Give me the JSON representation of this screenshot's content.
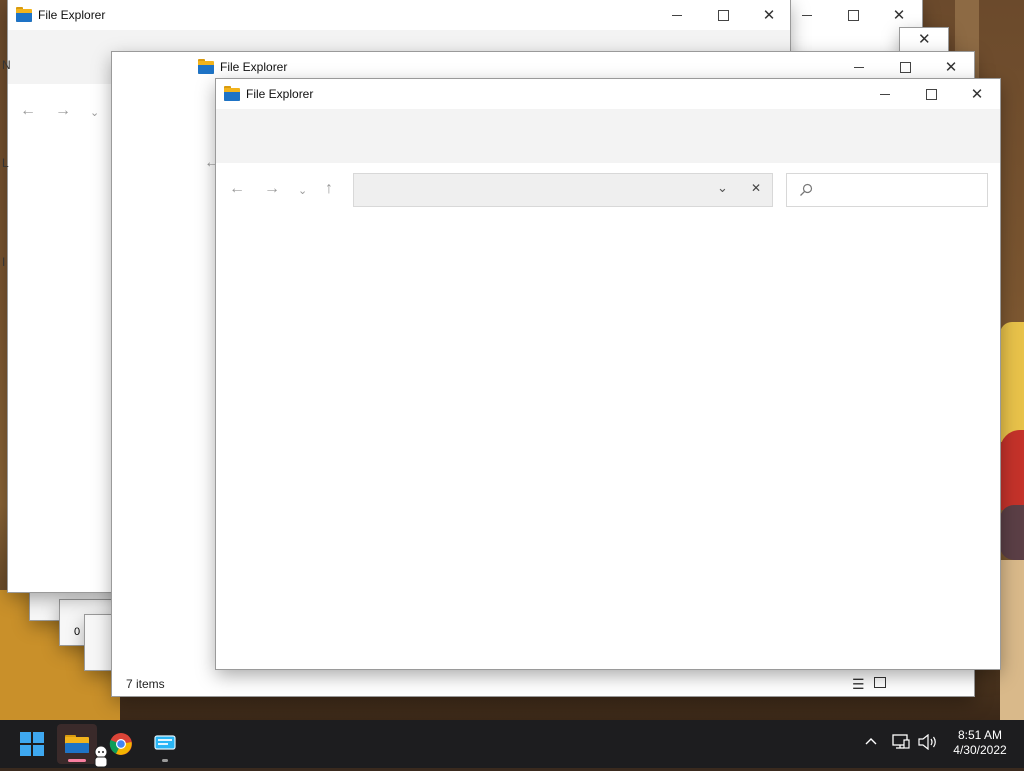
{
  "desktop": {
    "colors": {
      "taskbar": "#1d1d1f",
      "ribbon": "#f3f3f3",
      "accent_indicator": "#f87fa0"
    }
  },
  "windows": [
    {
      "title": "File Explorer",
      "icons": [
        "folder-icon",
        "minimize-icon",
        "maximize-icon",
        "close-icon"
      ]
    },
    {
      "title": "File Explorer",
      "status": "7 items",
      "icons": [
        "folder-icon",
        "minimize-icon",
        "maximize-icon",
        "close-icon",
        "details-view-icon",
        "tiles-view-icon"
      ]
    },
    {
      "title": "File Explorer",
      "address": {
        "value": "",
        "placeholder": ""
      },
      "search": {
        "value": "",
        "placeholder": ""
      },
      "icons": [
        "folder-icon",
        "minimize-icon",
        "maximize-icon",
        "close-icon",
        "back-arrow-icon",
        "forward-arrow-icon",
        "recent-dropdown-icon",
        "up-arrow-icon",
        "address-dropdown-icon",
        "clear-address-icon",
        "search-icon"
      ]
    }
  ],
  "background_fragments": {
    "left_cut_text": [
      "N",
      "L",
      "I"
    ],
    "stack_labels": [
      "0"
    ]
  },
  "taskbar": {
    "apps": [
      {
        "name": "start",
        "icon": "windows-logo-icon"
      },
      {
        "name": "file-explorer",
        "icon": "folder-icon",
        "active": true
      },
      {
        "name": "chrome",
        "icon": "chrome-icon"
      },
      {
        "name": "app",
        "icon": "monitor-app-icon"
      }
    ],
    "tray": {
      "icons": [
        "chevron-up-icon",
        "network-icon",
        "volume-icon"
      ],
      "time": "8:51 AM",
      "date": "4/30/2022"
    }
  }
}
